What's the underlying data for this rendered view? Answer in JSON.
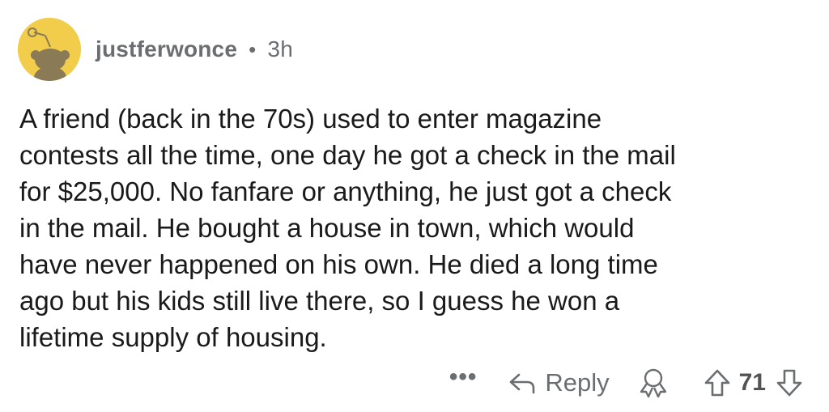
{
  "comment": {
    "author": "justferwonce",
    "separator": "•",
    "age": "3h",
    "text": "A friend (back in the 70s) used to enter magazine\ncontests all the time, one day he got a check in the mail\nfor $25,000. No fanfare or anything, he just got a check\nin the mail. He bought a house in town, which would\nhave never happened on his own. He died a long time\nago but his kids still live there, so I guess he won a\nlifetime supply of housing."
  },
  "actions": {
    "more_label": "•••",
    "reply_label": "Reply",
    "vote_count": "71"
  },
  "icons": {
    "avatar": "snoo-avatar-icon",
    "reply": "reply-arrow-icon",
    "award": "award-icon",
    "upvote": "upvote-arrow-icon",
    "downvote": "downvote-arrow-icon"
  },
  "colors": {
    "avatar_bg": "#f2cd4b",
    "meta_text": "#6b6e70",
    "body_text": "#1a1a1b"
  }
}
